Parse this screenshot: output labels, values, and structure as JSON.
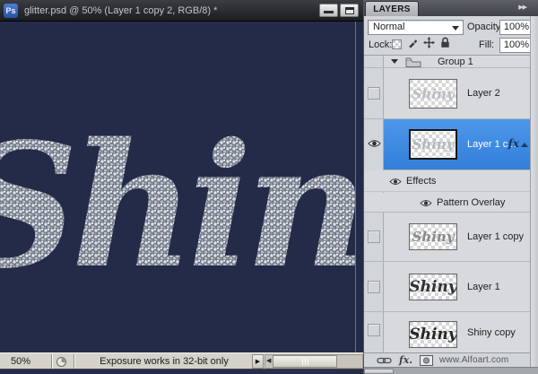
{
  "colors": {
    "accent_blue": "#3d8ce4",
    "canvas_bg": "#242b48",
    "panel_bg": "#d2d5d9",
    "titlebar_bg": "#2a2c30"
  },
  "window": {
    "ps_badge": "Ps",
    "title": "glitter.psd @ 50% (Layer 1 copy 2, RGB/8) *",
    "canvas_word": "Shiny"
  },
  "status_bar": {
    "zoom": "50%",
    "message": "Exposure works in 32-bit only"
  },
  "icons": {
    "panel_menu": "▶▶",
    "right_arrow": "▶",
    "left_arrow": "◀",
    "visibility": "eye-icon",
    "group_folder": "folder-icon",
    "link": "link-icon",
    "layer_mask": "mask-icon",
    "lock_set": [
      "lock-transparency-icon",
      "lock-image-icon",
      "lock-position-icon",
      "lock-all-icon"
    ]
  },
  "layers_panel": {
    "tab": "LAYERS",
    "blend_mode": "Normal",
    "opacity_label": "Opacity:",
    "opacity_value": "100%",
    "lock_label": "Lock:",
    "fill_label": "Fill:",
    "fill_value": "100%",
    "group": {
      "name": "Group 1"
    },
    "layers": [
      {
        "name": "Layer 2",
        "thumb_word": "Shiny",
        "selected": false,
        "visible": false
      },
      {
        "name": "Layer 1 c...",
        "thumb_word": "Shiny",
        "selected": true,
        "visible": true,
        "fx_badge": "fx"
      },
      {
        "name": "Layer 1 copy",
        "thumb_word": "Shiny",
        "selected": false,
        "visible": false
      },
      {
        "name": "Layer 1",
        "thumb_word": "Shiny",
        "selected": false,
        "visible": false
      },
      {
        "name": "Shiny copy",
        "thumb_word": "Shiny",
        "selected": false,
        "visible": false
      }
    ],
    "effects_label": "Effects",
    "pattern_overlay_label": "Pattern Overlay",
    "bottom_fx_label": "fx.",
    "watermark": "www.Alfoart.com"
  }
}
